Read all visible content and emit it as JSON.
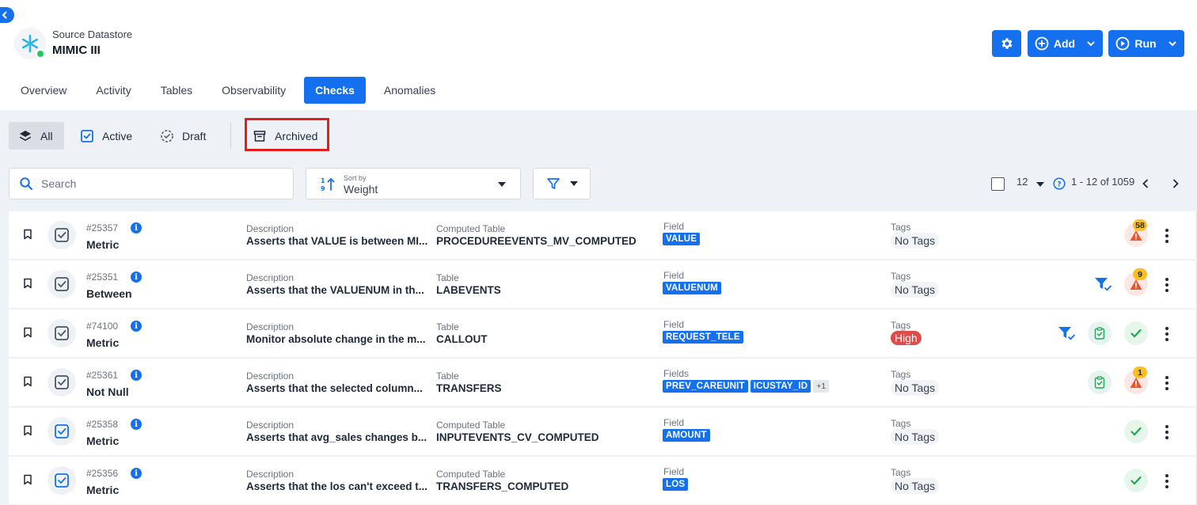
{
  "datastore": {
    "subtitle": "Source Datastore",
    "title": "MIMIC III",
    "status": "connected"
  },
  "header_buttons": {
    "settings_icon": "gear-icon",
    "add_label": "Add",
    "run_label": "Run"
  },
  "tabs": [
    {
      "label": "Overview",
      "active": false
    },
    {
      "label": "Activity",
      "active": false
    },
    {
      "label": "Tables",
      "active": false
    },
    {
      "label": "Observability",
      "active": false
    },
    {
      "label": "Checks",
      "active": true
    },
    {
      "label": "Anomalies",
      "active": false
    }
  ],
  "filters": {
    "all": "All",
    "active": "Active",
    "draft": "Draft",
    "archived": "Archived",
    "selected": "All"
  },
  "search": {
    "placeholder": "Search",
    "value": ""
  },
  "sort": {
    "caption": "Sort by",
    "value": "Weight"
  },
  "pagination": {
    "page_size": "12",
    "range": "1 - 12 of 1059"
  },
  "colors": {
    "accent": "#1570ef",
    "warning": "#e8552f",
    "success": "#22a653",
    "high_tag": "#dc4c4c",
    "highlight": "#e11d1d"
  },
  "checks": [
    {
      "id": "#25357",
      "type": "Metric",
      "description_label": "Description",
      "description": "Asserts that VALUE is between MI...",
      "table_label": "Computed Table",
      "table": "PROCEDUREEVENTS_MV_COMPUTED",
      "field_label": "Field",
      "fields": [
        "VALUE"
      ],
      "extra_fields": "",
      "tags_label": "Tags",
      "tag": "No Tags",
      "anomaly_count": "58",
      "status": "warning",
      "has_filter": false,
      "has_clipboard": false
    },
    {
      "id": "#25351",
      "type": "Between",
      "description_label": "Description",
      "description": "Asserts that the VALUENUM in th...",
      "table_label": "Table",
      "table": "LABEVENTS",
      "field_label": "Field",
      "fields": [
        "VALUENUM"
      ],
      "extra_fields": "",
      "tags_label": "Tags",
      "tag": "No Tags",
      "anomaly_count": "9",
      "status": "warning",
      "has_filter": true,
      "has_clipboard": false
    },
    {
      "id": "#74100",
      "type": "Metric",
      "description_label": "Description",
      "description": "Monitor absolute change in the m...",
      "table_label": "Table",
      "table": "CALLOUT",
      "field_label": "Field",
      "fields": [
        "REQUEST_TELE"
      ],
      "extra_fields": "",
      "tags_label": "Tags",
      "tag": "High",
      "anomaly_count": "",
      "status": "ok",
      "has_filter": true,
      "has_clipboard": true
    },
    {
      "id": "#25361",
      "type": "Not Null",
      "description_label": "Description",
      "description": "Asserts that the selected column...",
      "table_label": "Table",
      "table": "TRANSFERS",
      "field_label": "Fields",
      "fields": [
        "PREV_CAREUNIT",
        "ICUSTAY_ID"
      ],
      "extra_fields": "+1",
      "tags_label": "Tags",
      "tag": "No Tags",
      "anomaly_count": "1",
      "status": "warning",
      "has_filter": false,
      "has_clipboard": true
    },
    {
      "id": "#25358",
      "type": "Metric",
      "description_label": "Description",
      "description": "Asserts that avg_sales changes b...",
      "table_label": "Computed Table",
      "table": "INPUTEVENTS_CV_COMPUTED",
      "field_label": "Field",
      "fields": [
        "AMOUNT"
      ],
      "extra_fields": "",
      "tags_label": "Tags",
      "tag": "No Tags",
      "anomaly_count": "",
      "status": "ok",
      "has_filter": false,
      "has_clipboard": false
    },
    {
      "id": "#25356",
      "type": "Metric",
      "description_label": "Description",
      "description": "Asserts that the los can't exceed t...",
      "table_label": "Computed Table",
      "table": "TRANSFERS_COMPUTED",
      "field_label": "Field",
      "fields": [
        "LOS"
      ],
      "extra_fields": "",
      "tags_label": "Tags",
      "tag": "No Tags",
      "anomaly_count": "",
      "status": "ok",
      "has_filter": false,
      "has_clipboard": false
    }
  ]
}
